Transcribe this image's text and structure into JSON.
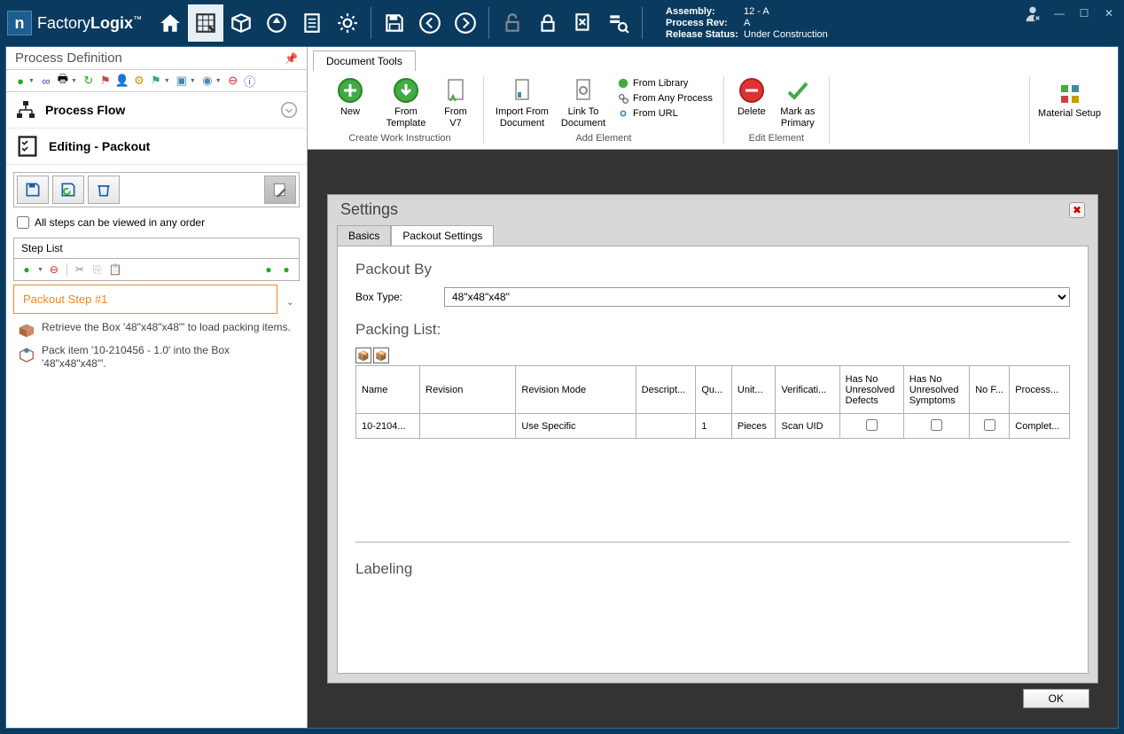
{
  "brand": {
    "name1": "Factory",
    "name2": "Logix"
  },
  "meta": {
    "assembly_label": "Assembly:",
    "assembly_value": "12 - A",
    "rev_label": "Process Rev:",
    "rev_value": "A",
    "status_label": "Release Status:",
    "status_value": "Under Construction"
  },
  "sidebar": {
    "title": "Process Definition",
    "process_flow": "Process Flow",
    "editing": "Editing - Packout",
    "all_steps_label": "All steps can be viewed in any order",
    "step_list_label": "Step List",
    "step1": "Packout Step #1",
    "sub1": "Retrieve the Box '48\"x48\"x48\"' to load packing items.",
    "sub2": "Pack item '10-210456 - 1.0' into the Box '48\"x48\"x48\"'."
  },
  "ribbon": {
    "tab": "Document Tools",
    "new": "New",
    "from_template": "From Template",
    "from_v7": "From V7",
    "group1": "Create Work Instruction",
    "import_from_doc": "Import From Document",
    "link_to_doc": "Link To Document",
    "from_library": "From Library",
    "from_any_process": "From Any Process",
    "from_url": "From URL",
    "group2": "Add Element",
    "delete": "Delete",
    "mark_primary": "Mark as Primary",
    "group3": "Edit Element",
    "material_setup": "Material Setup"
  },
  "settings": {
    "title": "Settings",
    "tab_basics": "Basics",
    "tab_packout": "Packout Settings",
    "packout_by": "Packout By",
    "box_type_label": "Box Type:",
    "box_type_value": "48\"x48\"x48\"",
    "packing_list": "Packing List:",
    "columns": {
      "name": "Name",
      "revision": "Revision",
      "revmode": "Revision Mode",
      "desc": "Descript...",
      "qty": "Qu...",
      "unit": "Unit...",
      "verif": "Verificati...",
      "nodef": "Has No Unresolved Defects",
      "nosymp": "Has No Unresolved Symptoms",
      "nof": "No F...",
      "process": "Process..."
    },
    "row1": {
      "name": "10-2104...",
      "revision": "",
      "revmode": "Use Specific",
      "desc": "",
      "qty": "1",
      "unit": "Pieces",
      "verif": "Scan UID",
      "process": "Complet..."
    },
    "labeling": "Labeling",
    "ok": "OK"
  }
}
